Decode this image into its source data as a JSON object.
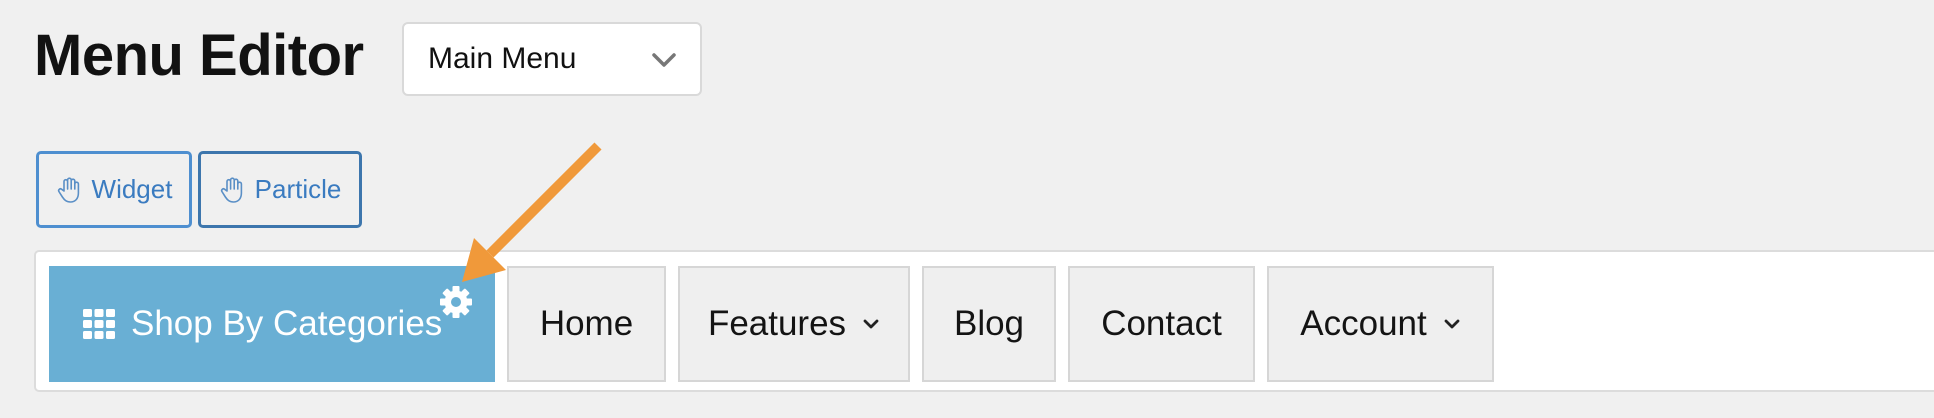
{
  "header": {
    "title": "Menu Editor",
    "menu_select": {
      "value": "Main Menu",
      "icon": "chevron-down-icon"
    }
  },
  "add_items": [
    {
      "label": "Widget",
      "icon": "hand-icon"
    },
    {
      "label": "Particle",
      "icon": "hand-icon"
    }
  ],
  "menu": {
    "items": [
      {
        "label": "Shop By Categories",
        "has_children": true,
        "active": true,
        "icon": "grid-icon",
        "settings_icon": "gear-icon"
      },
      {
        "label": "Home",
        "has_children": false
      },
      {
        "label": "Features",
        "has_children": true
      },
      {
        "label": "Blog",
        "has_children": false
      },
      {
        "label": "Contact",
        "has_children": false
      },
      {
        "label": "Account",
        "has_children": true
      }
    ]
  },
  "colors": {
    "active_item_bg": "#69afd4",
    "button_border": "#3f7db8",
    "annotation_arrow": "#f0993a"
  }
}
